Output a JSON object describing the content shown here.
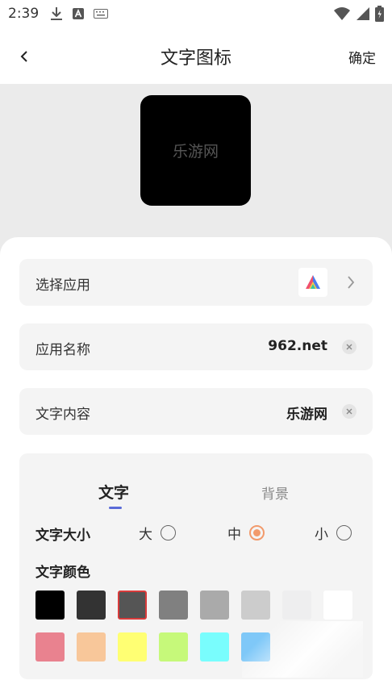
{
  "status_bar": {
    "time": "2:39"
  },
  "header": {
    "title": "文字图标",
    "confirm_label": "确定"
  },
  "preview": {
    "icon_text": "乐游网",
    "background_color": "#000000",
    "text_color": "#555555"
  },
  "form": {
    "select_app": {
      "label": "选择应用"
    },
    "app_name": {
      "label": "应用名称",
      "value": "962.net"
    },
    "text_content": {
      "label": "文字内容",
      "value": "乐游网"
    }
  },
  "style_panel": {
    "tabs": [
      {
        "label": "文字",
        "active": true
      },
      {
        "label": "背景",
        "active": false
      }
    ],
    "text_size": {
      "label": "文字大小",
      "options": [
        {
          "label": "大",
          "checked": false
        },
        {
          "label": "中",
          "checked": true
        },
        {
          "label": "小",
          "checked": false
        }
      ]
    },
    "text_color": {
      "label": "文字颜色",
      "swatches": [
        "#000000",
        "#333333",
        "#555555",
        "#808080",
        "#aaaaaa",
        "#cccccc",
        "#eeeeef",
        "#ffffff",
        "#e9828f",
        "#f8c79a",
        "#ffff73",
        "#c6f97a",
        "#79fdfd",
        "#7fc8f8"
      ],
      "selected_index": 2
    }
  },
  "colors": {
    "accent": "#5a6bd8",
    "radio_checked": "#f29a6b",
    "selected_swatch_border": "#d93b3b"
  }
}
